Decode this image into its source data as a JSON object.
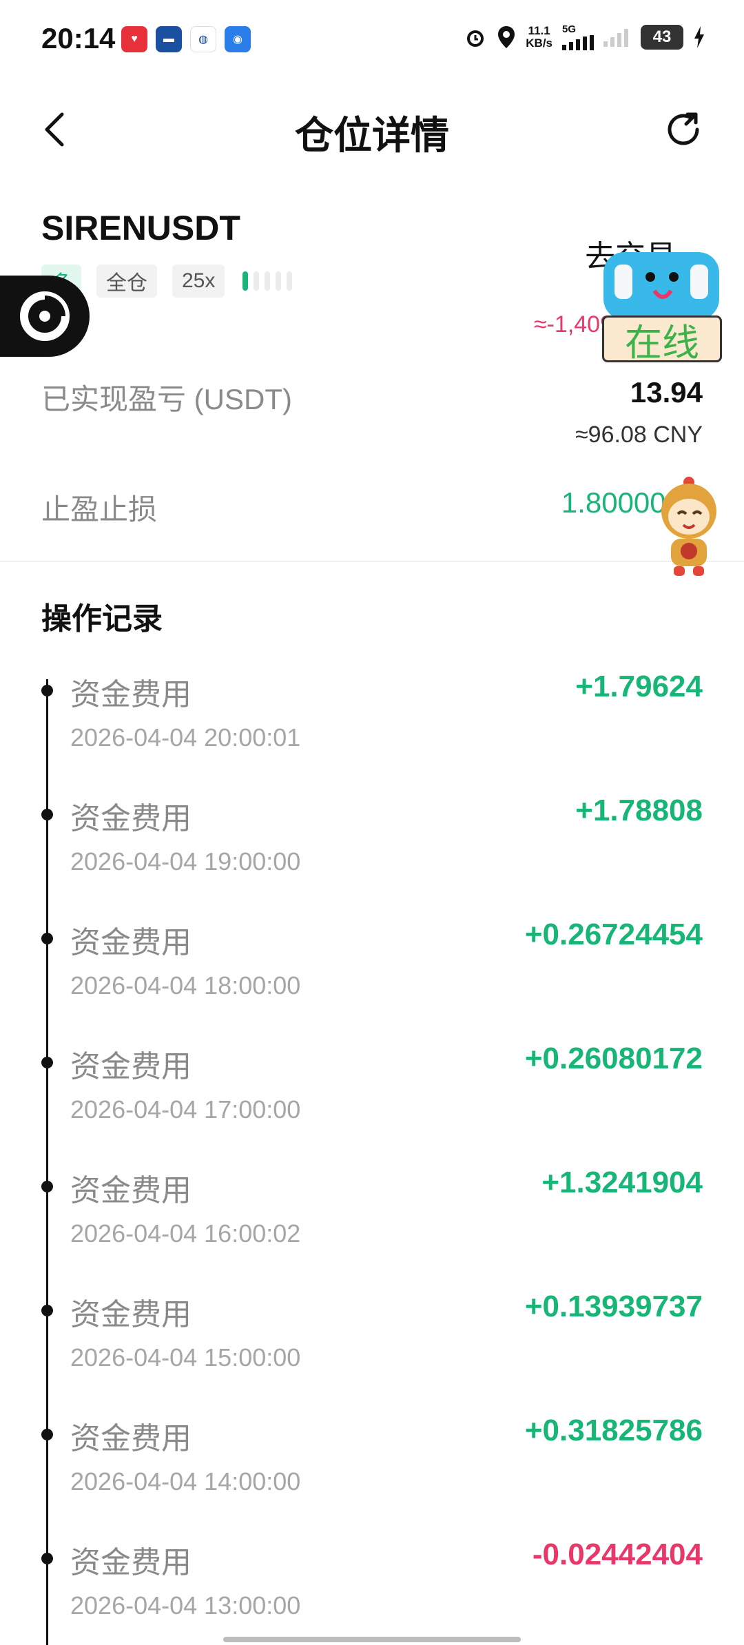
{
  "status_bar": {
    "time": "20:14",
    "net_speed": "11.1",
    "net_unit": "KB/s",
    "network": "5G",
    "battery": "43"
  },
  "header": {
    "title": "仓位详情"
  },
  "position": {
    "symbol": "SIRENUSDT",
    "side_tag": "多",
    "margin_mode": "全仓",
    "leverage": "25x",
    "trade_link": "去交易 ›",
    "unrealized_partial": "≈-1,409",
    "realized_label": "已实现盈亏 (USDT)",
    "realized_value": "13.94",
    "realized_cny": "≈96.08 CNY",
    "tpsl_label": "止盈止损",
    "tpsl_value": "1.80000 /"
  },
  "records": {
    "title": "操作记录",
    "items": [
      {
        "type": "资金费用",
        "time": "2026-04-04 20:00:01",
        "amount": "+1.79624",
        "sign": "pos"
      },
      {
        "type": "资金费用",
        "time": "2026-04-04 19:00:00",
        "amount": "+1.78808",
        "sign": "pos"
      },
      {
        "type": "资金费用",
        "time": "2026-04-04 18:00:00",
        "amount": "+0.26724454",
        "sign": "pos"
      },
      {
        "type": "资金费用",
        "time": "2026-04-04 17:00:00",
        "amount": "+0.26080172",
        "sign": "pos"
      },
      {
        "type": "资金费用",
        "time": "2026-04-04 16:00:02",
        "amount": "+1.3241904",
        "sign": "pos"
      },
      {
        "type": "资金费用",
        "time": "2026-04-04 15:00:00",
        "amount": "+0.13939737",
        "sign": "pos"
      },
      {
        "type": "资金费用",
        "time": "2026-04-04 14:00:00",
        "amount": "+0.31825786",
        "sign": "pos"
      },
      {
        "type": "资金费用",
        "time": "2026-04-04 13:00:00",
        "amount": "-0.02442404",
        "sign": "neg"
      }
    ]
  },
  "floating": {
    "online_label": "在线"
  },
  "colors": {
    "positive": "#17b676",
    "negative": "#e8386a"
  }
}
